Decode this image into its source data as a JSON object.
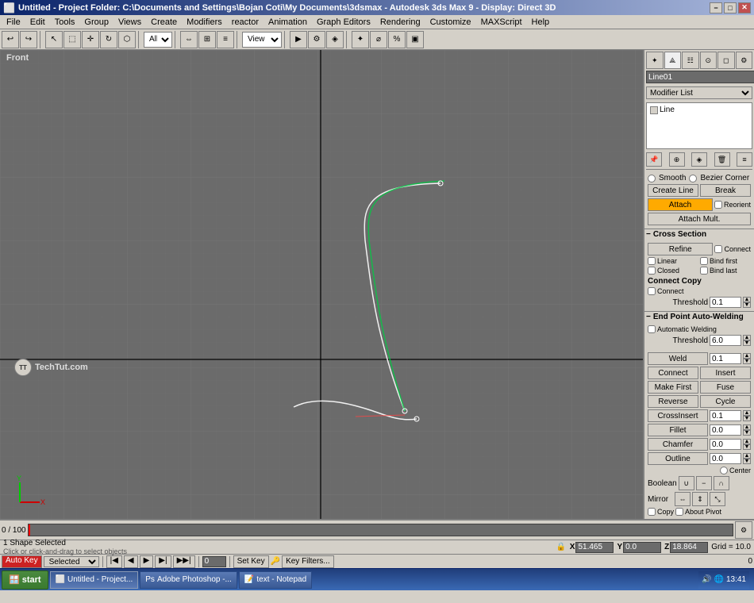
{
  "titlebar": {
    "icon": "3dsmax-icon",
    "title": "Untitled - Project Folder: C:\\Documents and Settings\\Bojan Coti\\My Documents\\3dsmax - Autodesk 3ds Max 9 - Display: Direct 3D",
    "short_title": "Untitled",
    "min_btn": "−",
    "max_btn": "□",
    "close_btn": "✕"
  },
  "menubar": {
    "items": [
      "File",
      "Edit",
      "Tools",
      "Group",
      "Views",
      "Create",
      "Modifiers",
      "reactor",
      "Animation",
      "Graph Editors",
      "Rendering",
      "Customize",
      "MAXScript",
      "Help"
    ]
  },
  "toolbar": {
    "undo_label": "↩",
    "redo_label": "↪",
    "select_label": "↖",
    "view_label": "View",
    "all_label": "All"
  },
  "viewport": {
    "label": "Front",
    "background_color": "#6b6b6b",
    "grid_color": "#7a7a7a",
    "axis_color_x": "#cc0000",
    "axis_color_y": "#00cc00"
  },
  "right_panel": {
    "object_name": "Line01",
    "object_color": "#00ff00",
    "modifier_list_label": "Modifier List",
    "stack_items": [
      {
        "name": "Line",
        "checked": true,
        "selected": false
      }
    ],
    "tabs": [
      "pin",
      "edit",
      "hierarchy",
      "motion",
      "display",
      "utilities"
    ],
    "smooth_label": "Smooth",
    "bezier_corner_label": "Bezier Corner",
    "create_line_label": "Create Line",
    "break_label": "Break",
    "attach_label": "Attach",
    "attach_mult_label": "Attach Mult.",
    "reorient_label": "Reorient",
    "cross_section_label": "Cross Section",
    "refine_label": "Refine",
    "connect_label": "Connect",
    "linear_label": "Linear",
    "bind_first_label": "Bind first",
    "closed_label": "Closed",
    "bind_last_label": "Bind last",
    "connect_copy_label": "Connect Copy",
    "connect2_label": "Connect",
    "threshold_label": "Threshold",
    "threshold_val": "0.1",
    "endpoint_welding_label": "End Point Auto-Welding",
    "automatic_welding_label": "Automatic Welding",
    "threshold2_label": "Threshold",
    "threshold2_val": "6.0",
    "weld_label": "Weld",
    "weld_val": "0.1",
    "insert_label": "Insert",
    "connect3_label": "Connect",
    "make_first_label": "Make First",
    "fuse_label": "Fuse",
    "reverse_label": "Reverse",
    "cycle_label": "Cycle",
    "crossinsert_label": "CrossInsert",
    "crossinsert_val": "0.1",
    "fillet_label": "Fillet",
    "fillet_val": "0.0",
    "chamfer_label": "Chamfer",
    "chamfer_val": "0.0",
    "outline_label": "Outline",
    "outline_val": "0.0",
    "center_label": "Center",
    "boolean_label": "Boolean",
    "mirror_label": "Mirror",
    "copy_label": "Copy",
    "about_pivot_label": "About Pivot"
  },
  "timeline": {
    "frame_start": "0",
    "frame_end": "100",
    "current_frame": "0",
    "display": "0 / 100"
  },
  "statusbar": {
    "shape_selected": "1 Shape Selected",
    "click_hint": "Click or click-and-drag to select objects",
    "x_label": "X",
    "x_val": "51.465",
    "y_label": "Y",
    "y_val": "0.0",
    "z_label": "Z",
    "z_val": "18.864",
    "grid_label": "Grid = 10.0",
    "autokey_label": "Auto Key",
    "selected_label": "Selected",
    "set_key_label": "Set Key",
    "key_filters_label": "Key Filters...",
    "frame_input_val": "0",
    "lock_icon": "🔒"
  },
  "taskbar": {
    "start_label": "start",
    "items": [
      {
        "label": "Untitled - Project...",
        "active": true,
        "icon": "3dsmax-icon"
      },
      {
        "label": "Adobe Photoshop -...",
        "active": false,
        "icon": "photoshop-icon"
      },
      {
        "label": "text - Notepad",
        "active": false,
        "icon": "notepad-icon"
      }
    ],
    "time": "13:41",
    "tray_icons": [
      "speaker",
      "network",
      "clock"
    ]
  },
  "watermark": {
    "logo": "TT",
    "text": "TechTut.com"
  },
  "colors": {
    "accent": "#0a246a",
    "active_btn": "#ffaa00",
    "viewport_bg": "#6b6b6b",
    "panel_bg": "#d4d0c8",
    "grid": "#7a7a7a"
  }
}
